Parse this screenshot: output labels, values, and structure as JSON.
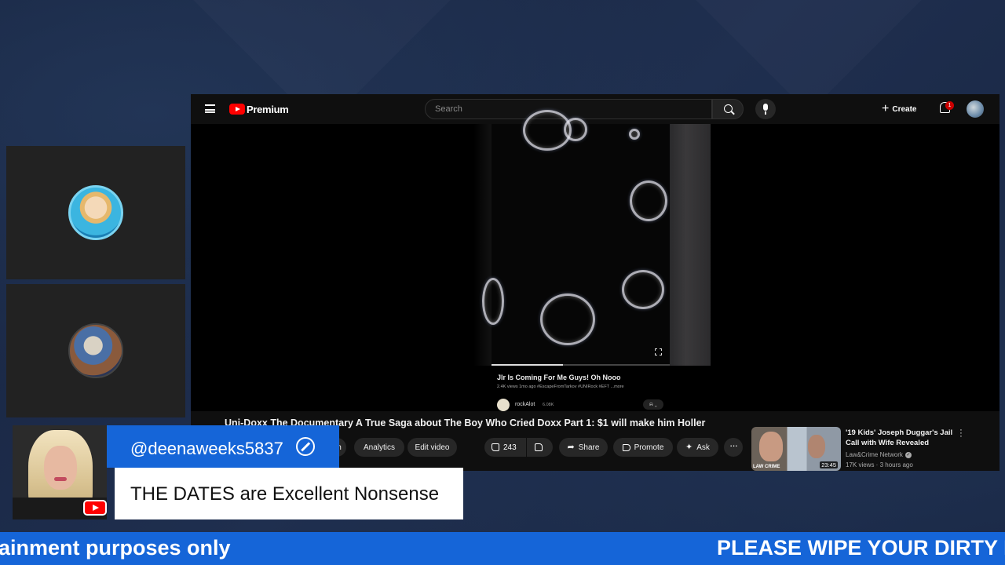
{
  "youtube": {
    "brand": "Premium",
    "search_placeholder": "Search",
    "create_label": "Create",
    "notification_count": "1"
  },
  "short": {
    "title": "Jlr Is Coming For Me Guys! Oh Nooo",
    "meta": "2.4K views  1mo ago  #EscapeFromTarkov  #UNIRock  #EFT  ...more",
    "channel": "rockAlot",
    "subscribers": "6.08K",
    "progress": 0.4
  },
  "video": {
    "title": "Uni-Doxx The Documentary A True Saga about The Boy Who Cried Doxx Part 1: $1 will make him Holler",
    "actions": {
      "partial_label": "n",
      "analytics": "Analytics",
      "edit_video": "Edit video",
      "likes": "243",
      "share": "Share",
      "promote": "Promote",
      "ask": "Ask",
      "more": "···"
    }
  },
  "recommended": {
    "title": "'19 Kids' Joseph Duggar's Jail Call with Wife Revealed",
    "channel": "Law&Crime Network",
    "meta": "17K views · 3 hours ago",
    "duration": "23:45",
    "thumb_logo": "LAW CRIME"
  },
  "chat": {
    "username": "@deenaweeks5837",
    "message": "THE DATES are Excellent Nonsense"
  },
  "ticker": {
    "left_text": "ainment purposes only",
    "right_text": "PLEASE WIPE YOUR DIRTY FE"
  },
  "colors": {
    "accent_blue": "#1565d8",
    "youtube_red": "#ff0000",
    "background": "#1c2a45"
  }
}
